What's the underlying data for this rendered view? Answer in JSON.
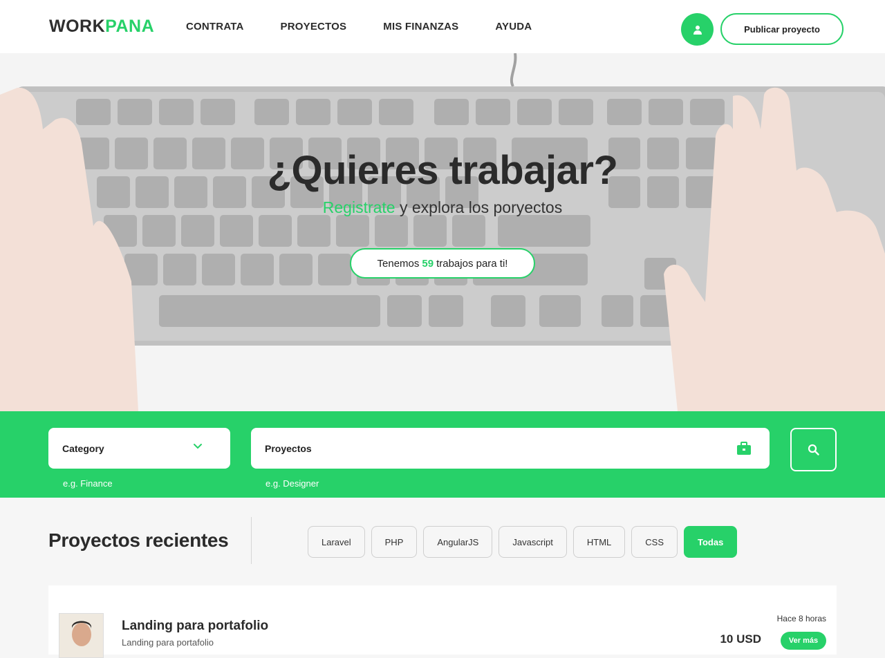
{
  "header": {
    "logo_part1": "WORK",
    "logo_part2": "PANA",
    "nav": [
      {
        "label": "CONTRATA"
      },
      {
        "label": "PROYECTOS"
      },
      {
        "label": "MIS FINANZAS"
      },
      {
        "label": "AYUDA"
      }
    ],
    "user_icon": "user-icon",
    "publish_label": "Publicar proyecto"
  },
  "hero": {
    "title": "¿Quieres trabajar?",
    "sub_highlight": "Registrate",
    "sub_rest": " y explora los poryectos",
    "jobs_prefix": "Tenemos",
    "jobs_count": "59",
    "jobs_suffix": "trabajos para ti!"
  },
  "search": {
    "category_label": "Category",
    "category_hint": "e.g. Finance",
    "projects_label": "Proyectos",
    "projects_hint": "e.g. Designer",
    "search_icon": "search-icon"
  },
  "recent": {
    "title": "Proyectos recientes",
    "filters": [
      {
        "label": "Laravel",
        "active": false
      },
      {
        "label": "PHP",
        "active": false
      },
      {
        "label": "AngularJS",
        "active": false
      },
      {
        "label": "Javascript",
        "active": false
      },
      {
        "label": "HTML",
        "active": false
      },
      {
        "label": "CSS",
        "active": false
      },
      {
        "label": "Todas",
        "active": true
      }
    ],
    "card": {
      "title": "Landing para portafolio",
      "subtitle": "Landing para portafolio",
      "time": "Hace 8 horas",
      "price": "10 USD",
      "button": "Ver más"
    }
  },
  "colors": {
    "accent": "#27d169",
    "text": "#2b2b2b"
  }
}
